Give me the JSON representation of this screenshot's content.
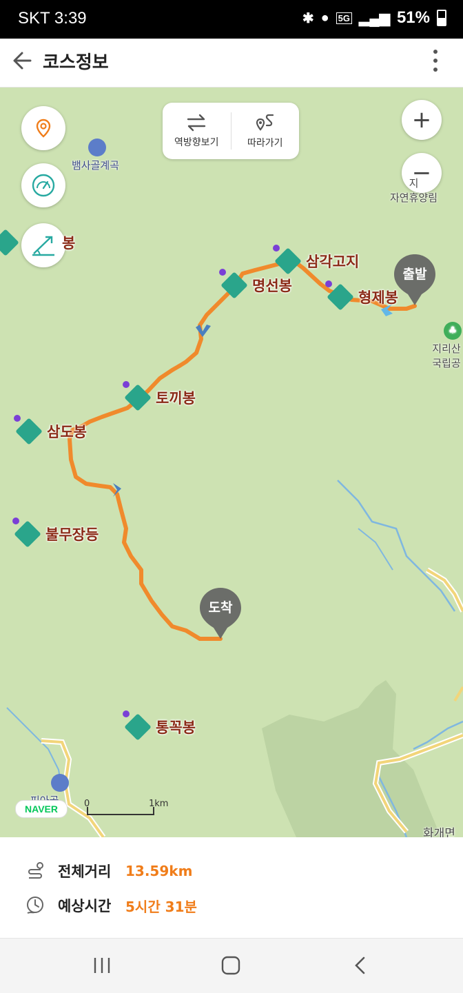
{
  "status_bar": {
    "carrier": "SKT",
    "time": "3:39",
    "network": "5G",
    "battery": "51%"
  },
  "header": {
    "title": "코스정보"
  },
  "map_controls": {
    "reverse_label": "역방향보기",
    "follow_label": "따라가기",
    "zoom_in": "+",
    "zoom_out": "−"
  },
  "peaks": [
    {
      "name": "삼각고지"
    },
    {
      "name": "명선봉"
    },
    {
      "name": "형제봉"
    },
    {
      "name": "토끼봉"
    },
    {
      "name": "삼도봉"
    },
    {
      "name": "불무장등"
    },
    {
      "name": "통꼭봉"
    },
    {
      "name": "봉"
    }
  ],
  "pois": {
    "valley": "뱀사골계곡",
    "forest": "자연휴양림",
    "forest_top": "지",
    "park_line1": "지리산",
    "park_line2": "국립공",
    "valley2": "피아골",
    "town": "화개면"
  },
  "markers": {
    "start": "출발",
    "end": "도착"
  },
  "map_footer": {
    "brand": "NAVER",
    "scale_start": "0",
    "scale_end": "1km"
  },
  "summary": {
    "distance_label": "전체거리",
    "distance_value": "13.59km",
    "time_label": "예상시간",
    "time_value": "5시간 31분"
  },
  "colors": {
    "route": "#f08a2c",
    "accent": "#f07d1a",
    "peak_icon": "#2aa58b",
    "map_bg": "#cde2b2"
  }
}
